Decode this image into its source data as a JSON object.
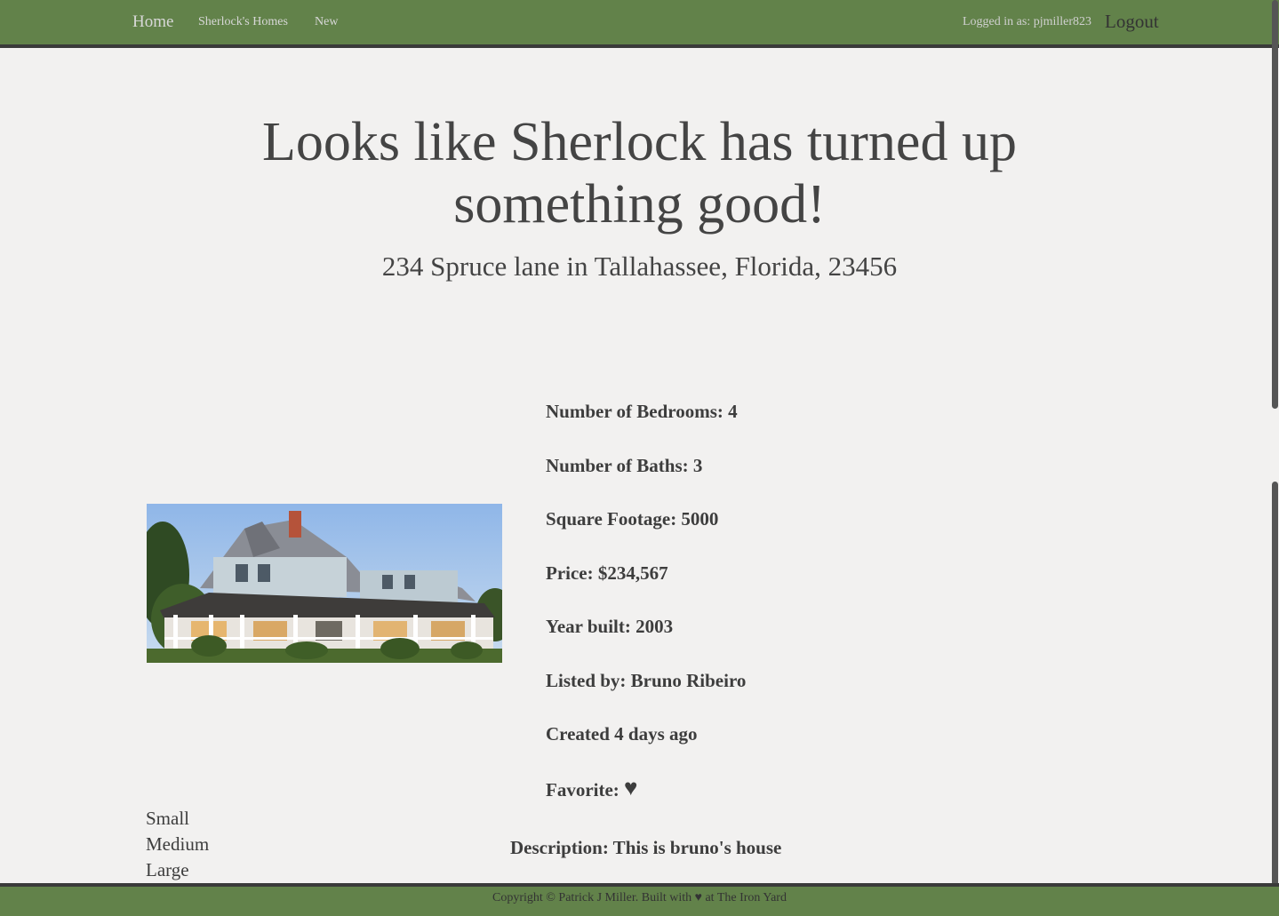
{
  "nav": {
    "home": "Home",
    "homes": "Sherlock's Homes",
    "new": "New",
    "logged_in": "Logged in as: pjmiller823",
    "logout": "Logout"
  },
  "hero": {
    "title_line1": "Looks like Sherlock has turned up",
    "title_line2": "something good!",
    "address": "234 Spruce lane in Tallahassee, Florida, 23456"
  },
  "details": {
    "bedrooms": "Number of Bedrooms: 4",
    "baths": "Number of Baths: 3",
    "sqft": "Square Footage: 5000",
    "price": "Price: $234,567",
    "year": "Year built: 2003",
    "listed_by": "Listed by: Bruno Ribeiro",
    "created": "Created 4 days ago",
    "favorite_label": "Favorite:",
    "favorite_icon": "♥"
  },
  "description": "Description: This is bruno's house",
  "sizes": [
    "Small",
    "Medium",
    "Large"
  ],
  "footer": "Copyright © Patrick J Miller. Built with ♥ at The Iron Yard",
  "colors": {
    "nav_bg": "#62824a",
    "page_bg": "#f2f1f0",
    "text": "#444444"
  }
}
